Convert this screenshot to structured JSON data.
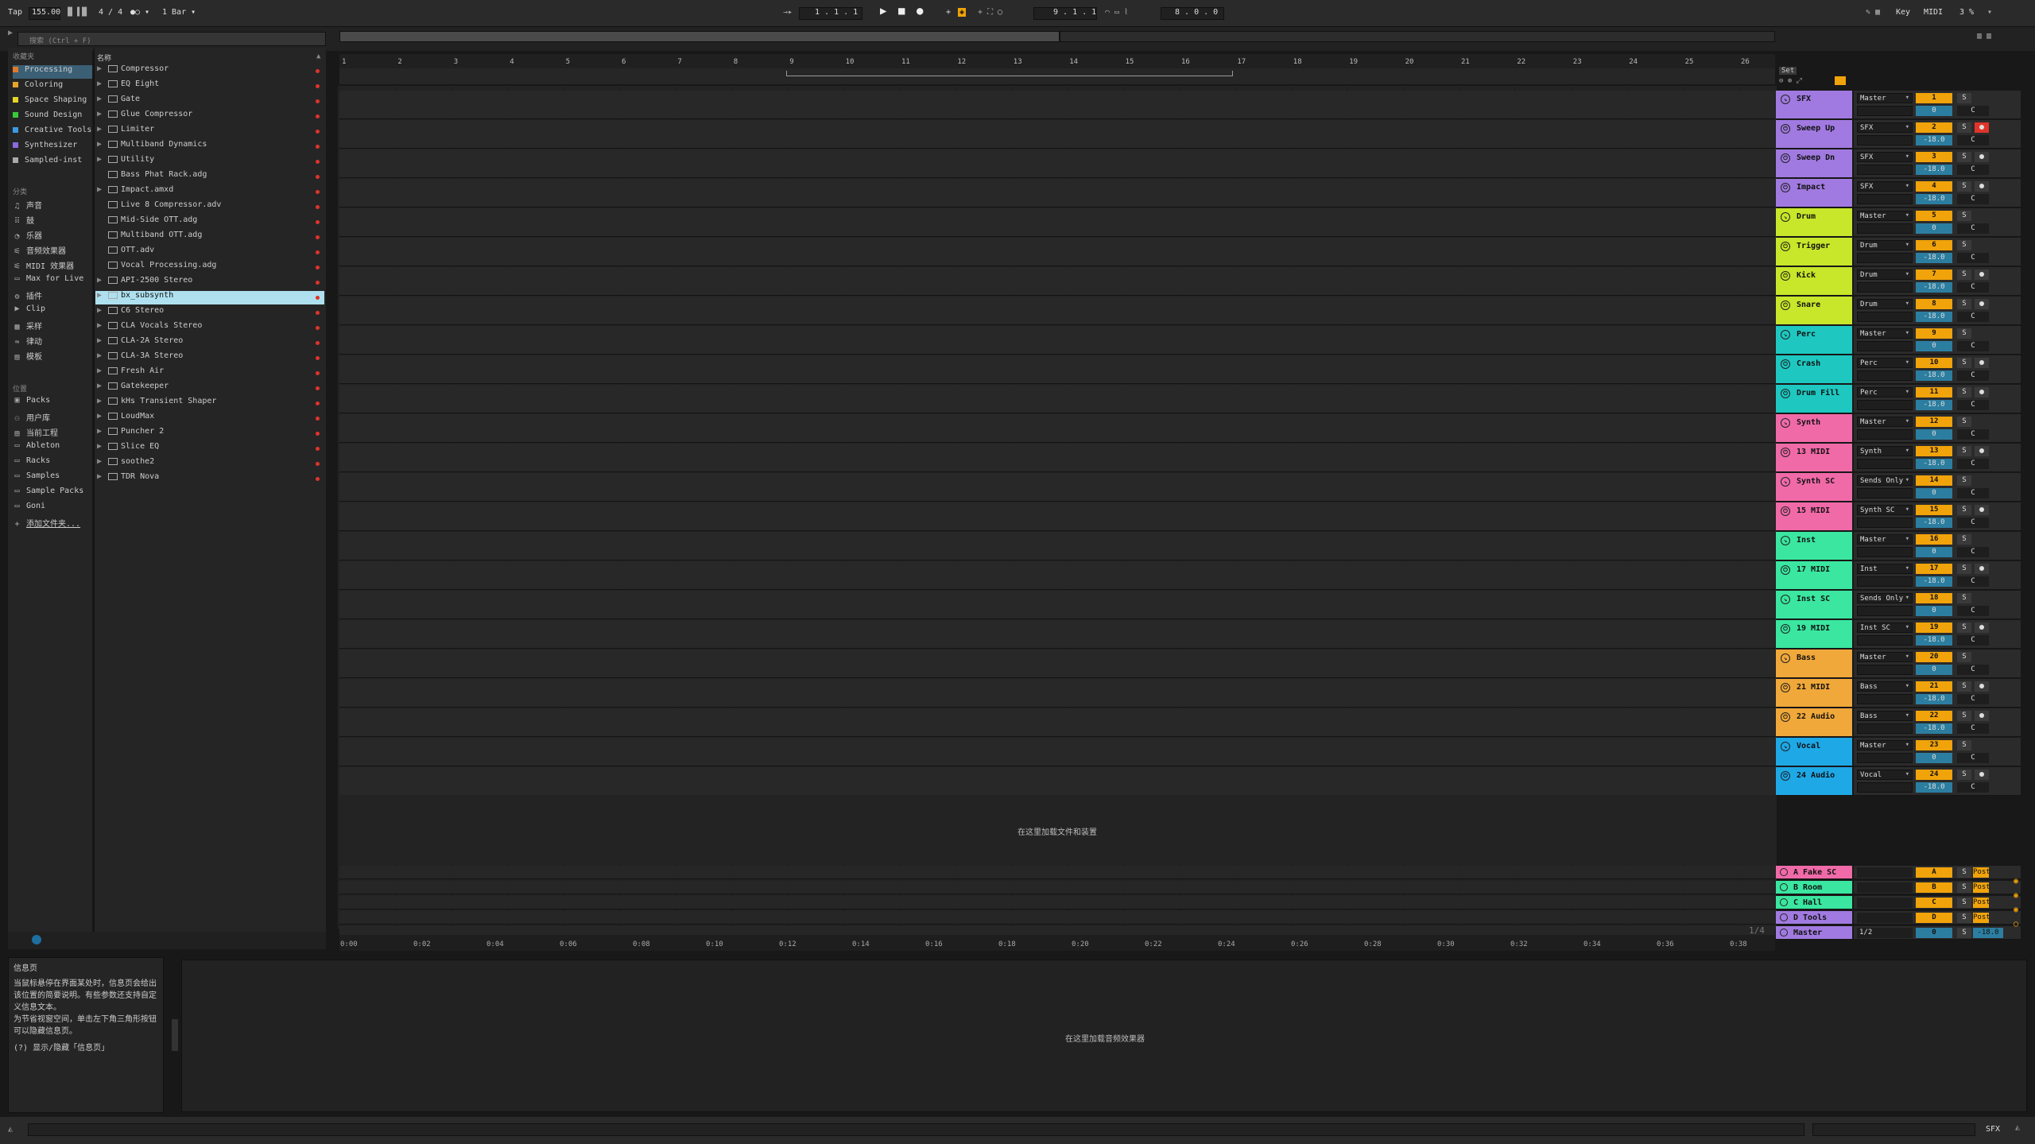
{
  "topbar": {
    "tap": "Tap",
    "tempo": "155.00",
    "meter": "4 / 4",
    "quant": "1 Bar ▾",
    "position": "1 .  1 .  1",
    "loop_start": "9 .  1 .  1",
    "loop_len": "8 .  0 .  0",
    "key": "Key",
    "midi": "MIDI",
    "cpu": "3 %"
  },
  "browser": {
    "search_placeholder": "搜索 (Ctrl + F)",
    "collections_header": "收藏夹",
    "collections": [
      {
        "label": "Processing",
        "color": "#e07a2a",
        "selected": true
      },
      {
        "label": "Coloring",
        "color": "#e6a52a"
      },
      {
        "label": "Space Shaping",
        "color": "#e6d42a"
      },
      {
        "label": "Sound Design",
        "color": "#3ac83a"
      },
      {
        "label": "Creative Tools",
        "color": "#3a9ae6"
      },
      {
        "label": "Synthesizer",
        "color": "#8a6ae0"
      },
      {
        "label": "Sampled-inst",
        "color": "#aaaaaa"
      }
    ],
    "categories_header": "分类",
    "categories": [
      {
        "label": "声音",
        "icon": "♫"
      },
      {
        "label": "鼓",
        "icon": "⠿"
      },
      {
        "label": "乐器",
        "icon": "◔"
      },
      {
        "label": "音频效果器",
        "icon": "⚟"
      },
      {
        "label": "MIDI 效果器",
        "icon": "⚟"
      },
      {
        "label": "Max for Live",
        "icon": "▭"
      },
      {
        "label": "插件",
        "icon": "⚙"
      },
      {
        "label": "Clip",
        "icon": "▶"
      },
      {
        "label": "采样",
        "icon": "▦"
      },
      {
        "label": "律动",
        "icon": "≈"
      },
      {
        "label": "模板",
        "icon": "▤"
      }
    ],
    "places_header": "位置",
    "places": [
      {
        "label": "Packs",
        "icon": "▣"
      },
      {
        "label": "用户库",
        "icon": "⚇"
      },
      {
        "label": "当前工程",
        "icon": "▤"
      },
      {
        "label": "Ableton",
        "icon": "▭"
      },
      {
        "label": "Racks",
        "icon": "▭"
      },
      {
        "label": "Samples",
        "icon": "▭"
      },
      {
        "label": "Sample Packs",
        "icon": "▭"
      },
      {
        "label": "Goni",
        "icon": "▭"
      },
      {
        "label": "添加文件夹...",
        "icon": "+"
      }
    ],
    "name_header": "名称",
    "items": [
      {
        "label": "Compressor",
        "arrow": "▶",
        "sel": false
      },
      {
        "label": "EQ Eight",
        "arrow": "▶"
      },
      {
        "label": "Gate",
        "arrow": "▶"
      },
      {
        "label": "Glue Compressor",
        "arrow": "▶"
      },
      {
        "label": "Limiter",
        "arrow": "▶"
      },
      {
        "label": "Multiband Dynamics",
        "arrow": "▶"
      },
      {
        "label": "Utility",
        "arrow": "▶"
      },
      {
        "label": "Bass Phat Rack.adg",
        "arrow": ""
      },
      {
        "label": "Impact.amxd",
        "arrow": "▶"
      },
      {
        "label": "Live 8 Compressor.adv",
        "arrow": ""
      },
      {
        "label": "Mid-Side OTT.adg",
        "arrow": ""
      },
      {
        "label": "Multiband OTT.adg",
        "arrow": ""
      },
      {
        "label": "OTT.adv",
        "arrow": ""
      },
      {
        "label": "Vocal Processing.adg",
        "arrow": ""
      },
      {
        "label": "API-2500 Stereo",
        "arrow": "▶"
      },
      {
        "label": "bx_subsynth",
        "arrow": "▶",
        "sel": true
      },
      {
        "label": "C6 Stereo",
        "arrow": "▶"
      },
      {
        "label": "CLA Vocals Stereo",
        "arrow": "▶"
      },
      {
        "label": "CLA-2A Stereo",
        "arrow": "▶"
      },
      {
        "label": "CLA-3A Stereo",
        "arrow": "▶"
      },
      {
        "label": "Fresh Air",
        "arrow": "▶"
      },
      {
        "label": "Gatekeeper",
        "arrow": "▶"
      },
      {
        "label": "kHs Transient Shaper",
        "arrow": "▶"
      },
      {
        "label": "LoudMax",
        "arrow": "▶"
      },
      {
        "label": "Puncher 2",
        "arrow": "▶"
      },
      {
        "label": "Slice EQ",
        "arrow": "▶"
      },
      {
        "label": "soothe2",
        "arrow": "▶"
      },
      {
        "label": "TDR Nova",
        "arrow": "▶"
      }
    ]
  },
  "ruler": [
    "1",
    "2",
    "3",
    "4",
    "5",
    "6",
    "7",
    "8",
    "9",
    "10",
    "11",
    "12",
    "13",
    "14",
    "15",
    "16",
    "17",
    "18",
    "19",
    "20",
    "21",
    "22",
    "23",
    "24",
    "25",
    "26"
  ],
  "set_label": "Set",
  "tracks": [
    {
      "name": "SFX",
      "color": "#a07ae0",
      "group": true,
      "route": "Master",
      "num": "1",
      "vol": "0",
      "arm": false
    },
    {
      "name": "Sweep Up",
      "color": "#a07ae0",
      "route": "SFX",
      "num": "2",
      "vol": "-18.0",
      "arm": true,
      "armred": true
    },
    {
      "name": "Sweep Dn",
      "color": "#a07ae0",
      "route": "SFX",
      "num": "3",
      "vol": "-18.0",
      "arm": true
    },
    {
      "name": "Impact",
      "color": "#a07ae0",
      "route": "SFX",
      "num": "4",
      "vol": "-18.0",
      "arm": true
    },
    {
      "name": "Drum",
      "color": "#c8e62a",
      "group": true,
      "route": "Master",
      "num": "5",
      "vol": "0"
    },
    {
      "name": "Trigger",
      "color": "#c8e62a",
      "route": "Drum",
      "num": "6",
      "vol": "-18.0"
    },
    {
      "name": "Kick",
      "color": "#c8e62a",
      "route": "Drum",
      "num": "7",
      "vol": "-18.0",
      "arm": true
    },
    {
      "name": "Snare",
      "color": "#c8e62a",
      "route": "Drum",
      "num": "8",
      "vol": "-18.0",
      "arm": true
    },
    {
      "name": "Perc",
      "color": "#1ec8c0",
      "group": true,
      "route": "Master",
      "num": "9",
      "vol": "0"
    },
    {
      "name": "Crash",
      "color": "#1ec8c0",
      "route": "Perc",
      "num": "10",
      "vol": "-18.0",
      "arm": true
    },
    {
      "name": "Drum Fill",
      "color": "#1ec8c0",
      "route": "Perc",
      "num": "11",
      "vol": "-18.0",
      "arm": true
    },
    {
      "name": "Synth",
      "color": "#f06aa8",
      "group": true,
      "route": "Master",
      "num": "12",
      "vol": "0"
    },
    {
      "name": "13 MIDI",
      "color": "#f06aa8",
      "route": "Synth",
      "num": "13",
      "vol": "-18.0",
      "arm": true
    },
    {
      "name": "Synth SC",
      "color": "#f06aa8",
      "group": true,
      "route": "Sends Only",
      "num": "14",
      "vol": "0"
    },
    {
      "name": "15 MIDI",
      "color": "#f06aa8",
      "route": "Synth SC",
      "num": "15",
      "vol": "-18.0",
      "arm": true
    },
    {
      "name": "Inst",
      "color": "#3ae6a0",
      "group": true,
      "route": "Master",
      "num": "16",
      "vol": "0"
    },
    {
      "name": "17 MIDI",
      "color": "#3ae6a0",
      "route": "Inst",
      "num": "17",
      "vol": "-18.0",
      "arm": true
    },
    {
      "name": "Inst SC",
      "color": "#3ae6a0",
      "group": true,
      "route": "Sends Only",
      "num": "18",
      "vol": "0"
    },
    {
      "name": "19 MIDI",
      "color": "#3ae6a0",
      "route": "Inst SC",
      "num": "19",
      "vol": "-18.0",
      "arm": true
    },
    {
      "name": "Bass",
      "color": "#f0a83a",
      "group": true,
      "route": "Master",
      "num": "20",
      "vol": "0"
    },
    {
      "name": "21 MIDI",
      "color": "#f0a83a",
      "route": "Bass",
      "num": "21",
      "vol": "-18.0",
      "arm": true
    },
    {
      "name": "22 Audio",
      "color": "#f0a83a",
      "route": "Bass",
      "num": "22",
      "vol": "-18.0",
      "arm": true
    },
    {
      "name": "Vocal",
      "color": "#1ea8e6",
      "group": true,
      "route": "Master",
      "num": "23",
      "vol": "0"
    },
    {
      "name": "24 Audio",
      "color": "#1ea8e6",
      "route": "Vocal",
      "num": "24",
      "vol": "-18.0",
      "arm": true
    }
  ],
  "drop_files": "在这里加载文件和装置",
  "returns": [
    {
      "name": "A Fake SC",
      "color": "#f06aa8",
      "num": "A",
      "post": "Post"
    },
    {
      "name": "B Room",
      "color": "#3ae6a0",
      "num": "B",
      "post": "Post"
    },
    {
      "name": "C Hall",
      "color": "#3ae6a0",
      "num": "C",
      "post": "Post"
    },
    {
      "name": "D Tools",
      "color": "#a07ae0",
      "num": "D",
      "post": "Post"
    },
    {
      "name": "Master",
      "color": "#a07ae0",
      "num": "0",
      "post": "-18.0",
      "route": "1/2"
    }
  ],
  "timeline": [
    "0:00",
    "0:02",
    "0:04",
    "0:06",
    "0:08",
    "0:10",
    "0:12",
    "0:14",
    "0:16",
    "0:18",
    "0:20",
    "0:22",
    "0:24",
    "0:26",
    "0:28",
    "0:30",
    "0:32",
    "0:34",
    "0:36",
    "0:38"
  ],
  "page_num": "1/4",
  "info": {
    "title": "信息页",
    "body": "当鼠标悬停在界面某处时，信息页会给出该位置的简要说明。有些参数还支持自定义信息文本。",
    "body2": "为节省视窗空间，单击左下角三角形按钮可以隐藏信息页。",
    "shortcut": "(?) 显示/隐藏「信息页」"
  },
  "device_drop": "在这里加载音频效果器",
  "status_track": "SFX"
}
